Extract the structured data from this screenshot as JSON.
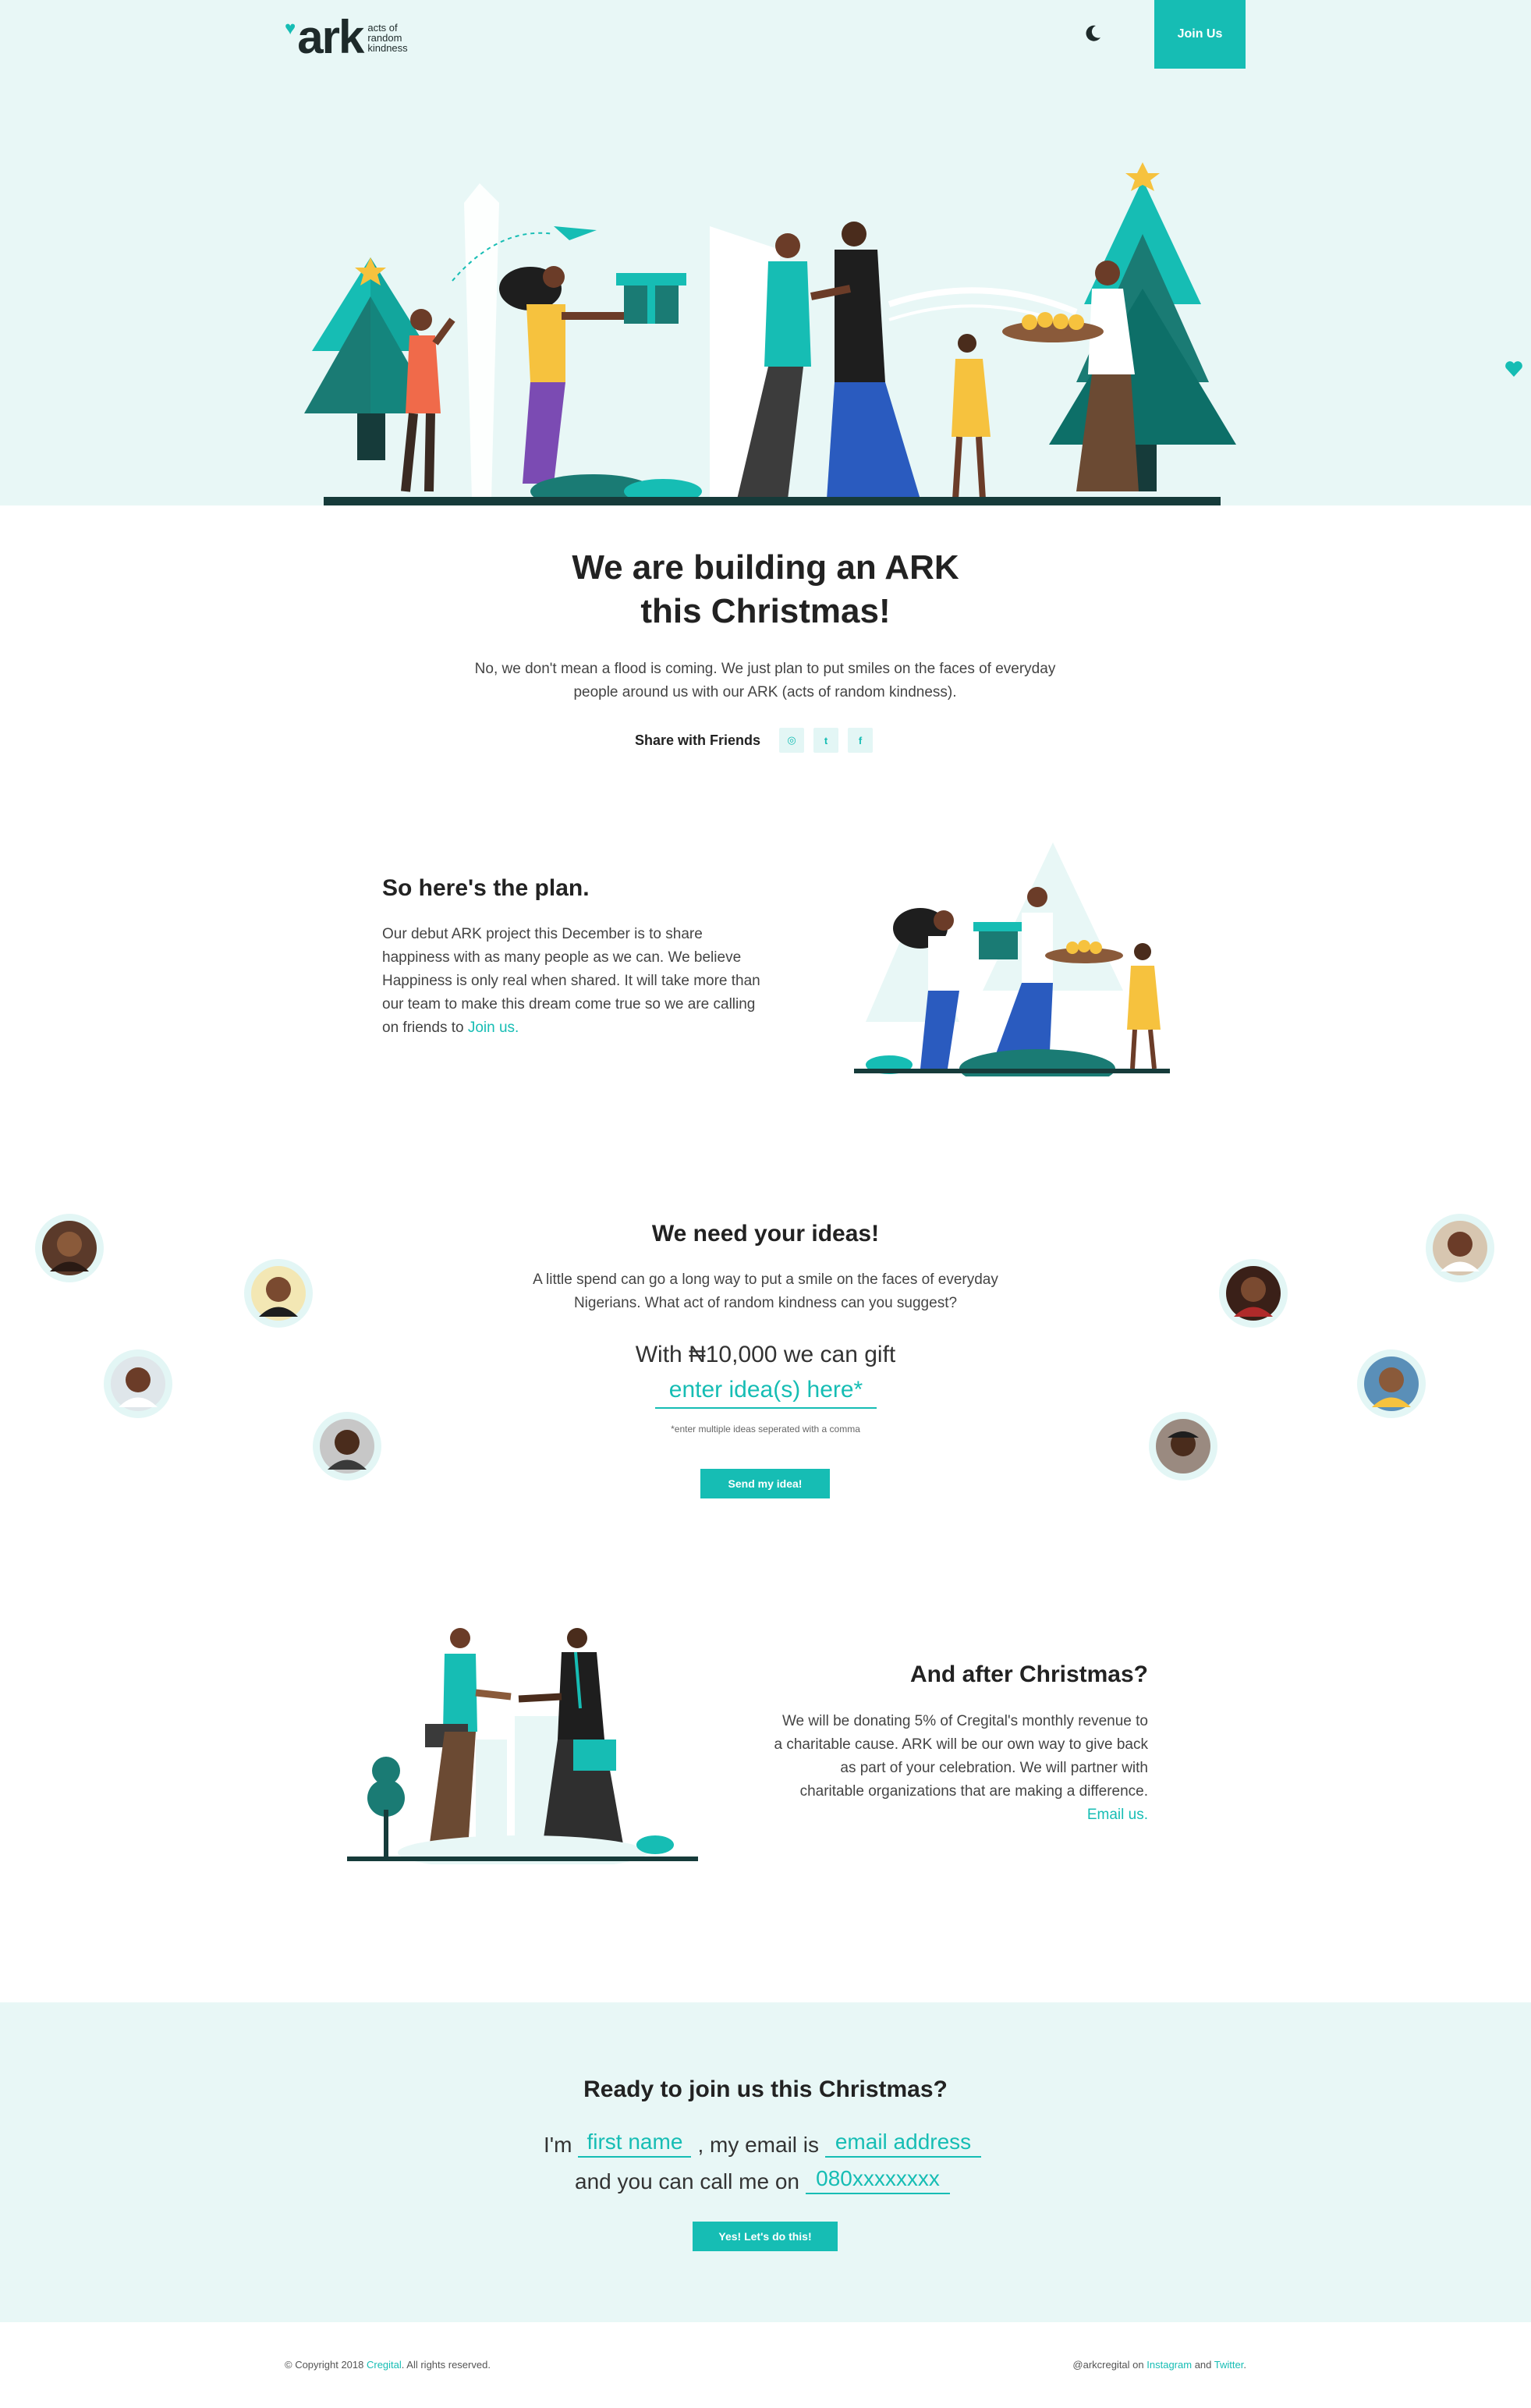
{
  "brand": {
    "logo_word": "ark",
    "logo_tag": [
      "acts of",
      "random",
      "kindness"
    ],
    "accent_color": "#16bdb4",
    "hero_bg": "#e8f7f6",
    "dark_teal": "#1a7b74"
  },
  "header": {
    "theme_toggle_icon": "moon-icon",
    "join_label": "Join Us"
  },
  "intro": {
    "title_line1": "We are building an ARK",
    "title_line2": "this Christmas!",
    "description": "No, we don't mean a flood is coming. We just plan to put smiles on the faces of everyday people around us with our ARK (acts of random kindness).",
    "share_label": "Share with Friends",
    "share_icons": [
      "instagram-icon",
      "twitter-icon",
      "facebook-icon"
    ],
    "share_glyphs": [
      "◎",
      "t",
      "f"
    ]
  },
  "plan": {
    "title": "So here's the plan.",
    "text": "Our debut ARK project this December is to share happiness with as many people as we can. We believe Happiness is only real when shared. It will take more than our team to make this dream come true so we are calling on friends to",
    "link": "Join us."
  },
  "ideas": {
    "title": "We need your ideas!",
    "description": "A little spend can go a long way to put a smile on the faces of everyday Nigerians. What act of random kindness can you suggest?",
    "gift_line": "With ₦10,000 we can gift",
    "input_placeholder": "enter idea(s) here*",
    "hint": "*enter multiple ideas seperated with a comma",
    "button": "Send my idea!"
  },
  "after": {
    "title": "And after Christmas?",
    "text": "We will be donating 5% of Cregital's monthly revenue to a charitable cause. ARK will be our own way to give back as part of your celebration. We will partner with charitable organizations that are making a difference.",
    "link": "Email us."
  },
  "join": {
    "title": "Ready to join us this Christmas?",
    "im": "I'm",
    "first_name_placeholder": "first name",
    "email_prefix": ", my email is",
    "email_placeholder": "email address",
    "phone_prefix": "and you can call me on",
    "phone_placeholder": "080xxxxxxxx",
    "button": "Yes! Let's do this!"
  },
  "footer": {
    "copyright_pre": "© Copyright 2018",
    "company": "Cregital",
    "copyright_post": ". All rights reserved.",
    "handle_pre": "@arkcregital on",
    "instagram": "Instagram",
    "and": "and",
    "twitter": "Twitter",
    "end": "."
  }
}
